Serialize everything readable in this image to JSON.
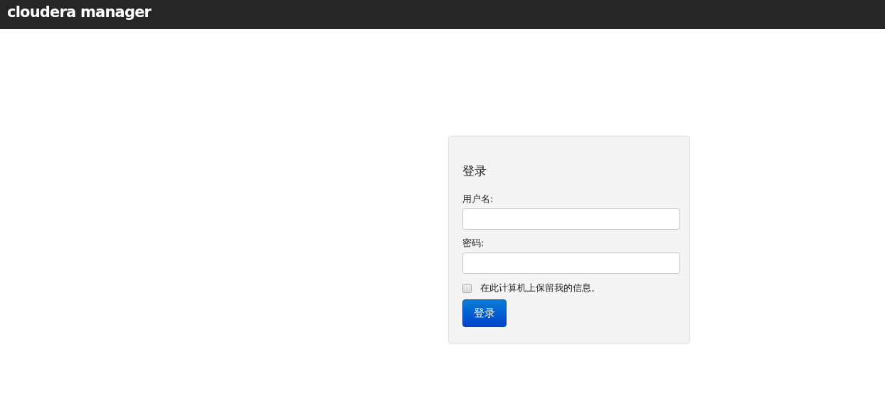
{
  "header": {
    "logo": "cloudera manager"
  },
  "login": {
    "title": "登录",
    "fields": [
      {
        "label": "用户名:"
      },
      {
        "label": "密码:"
      }
    ],
    "remember": {
      "label": "在此计算机上保留我的信息。",
      "checked": false
    },
    "button": "登录"
  }
}
